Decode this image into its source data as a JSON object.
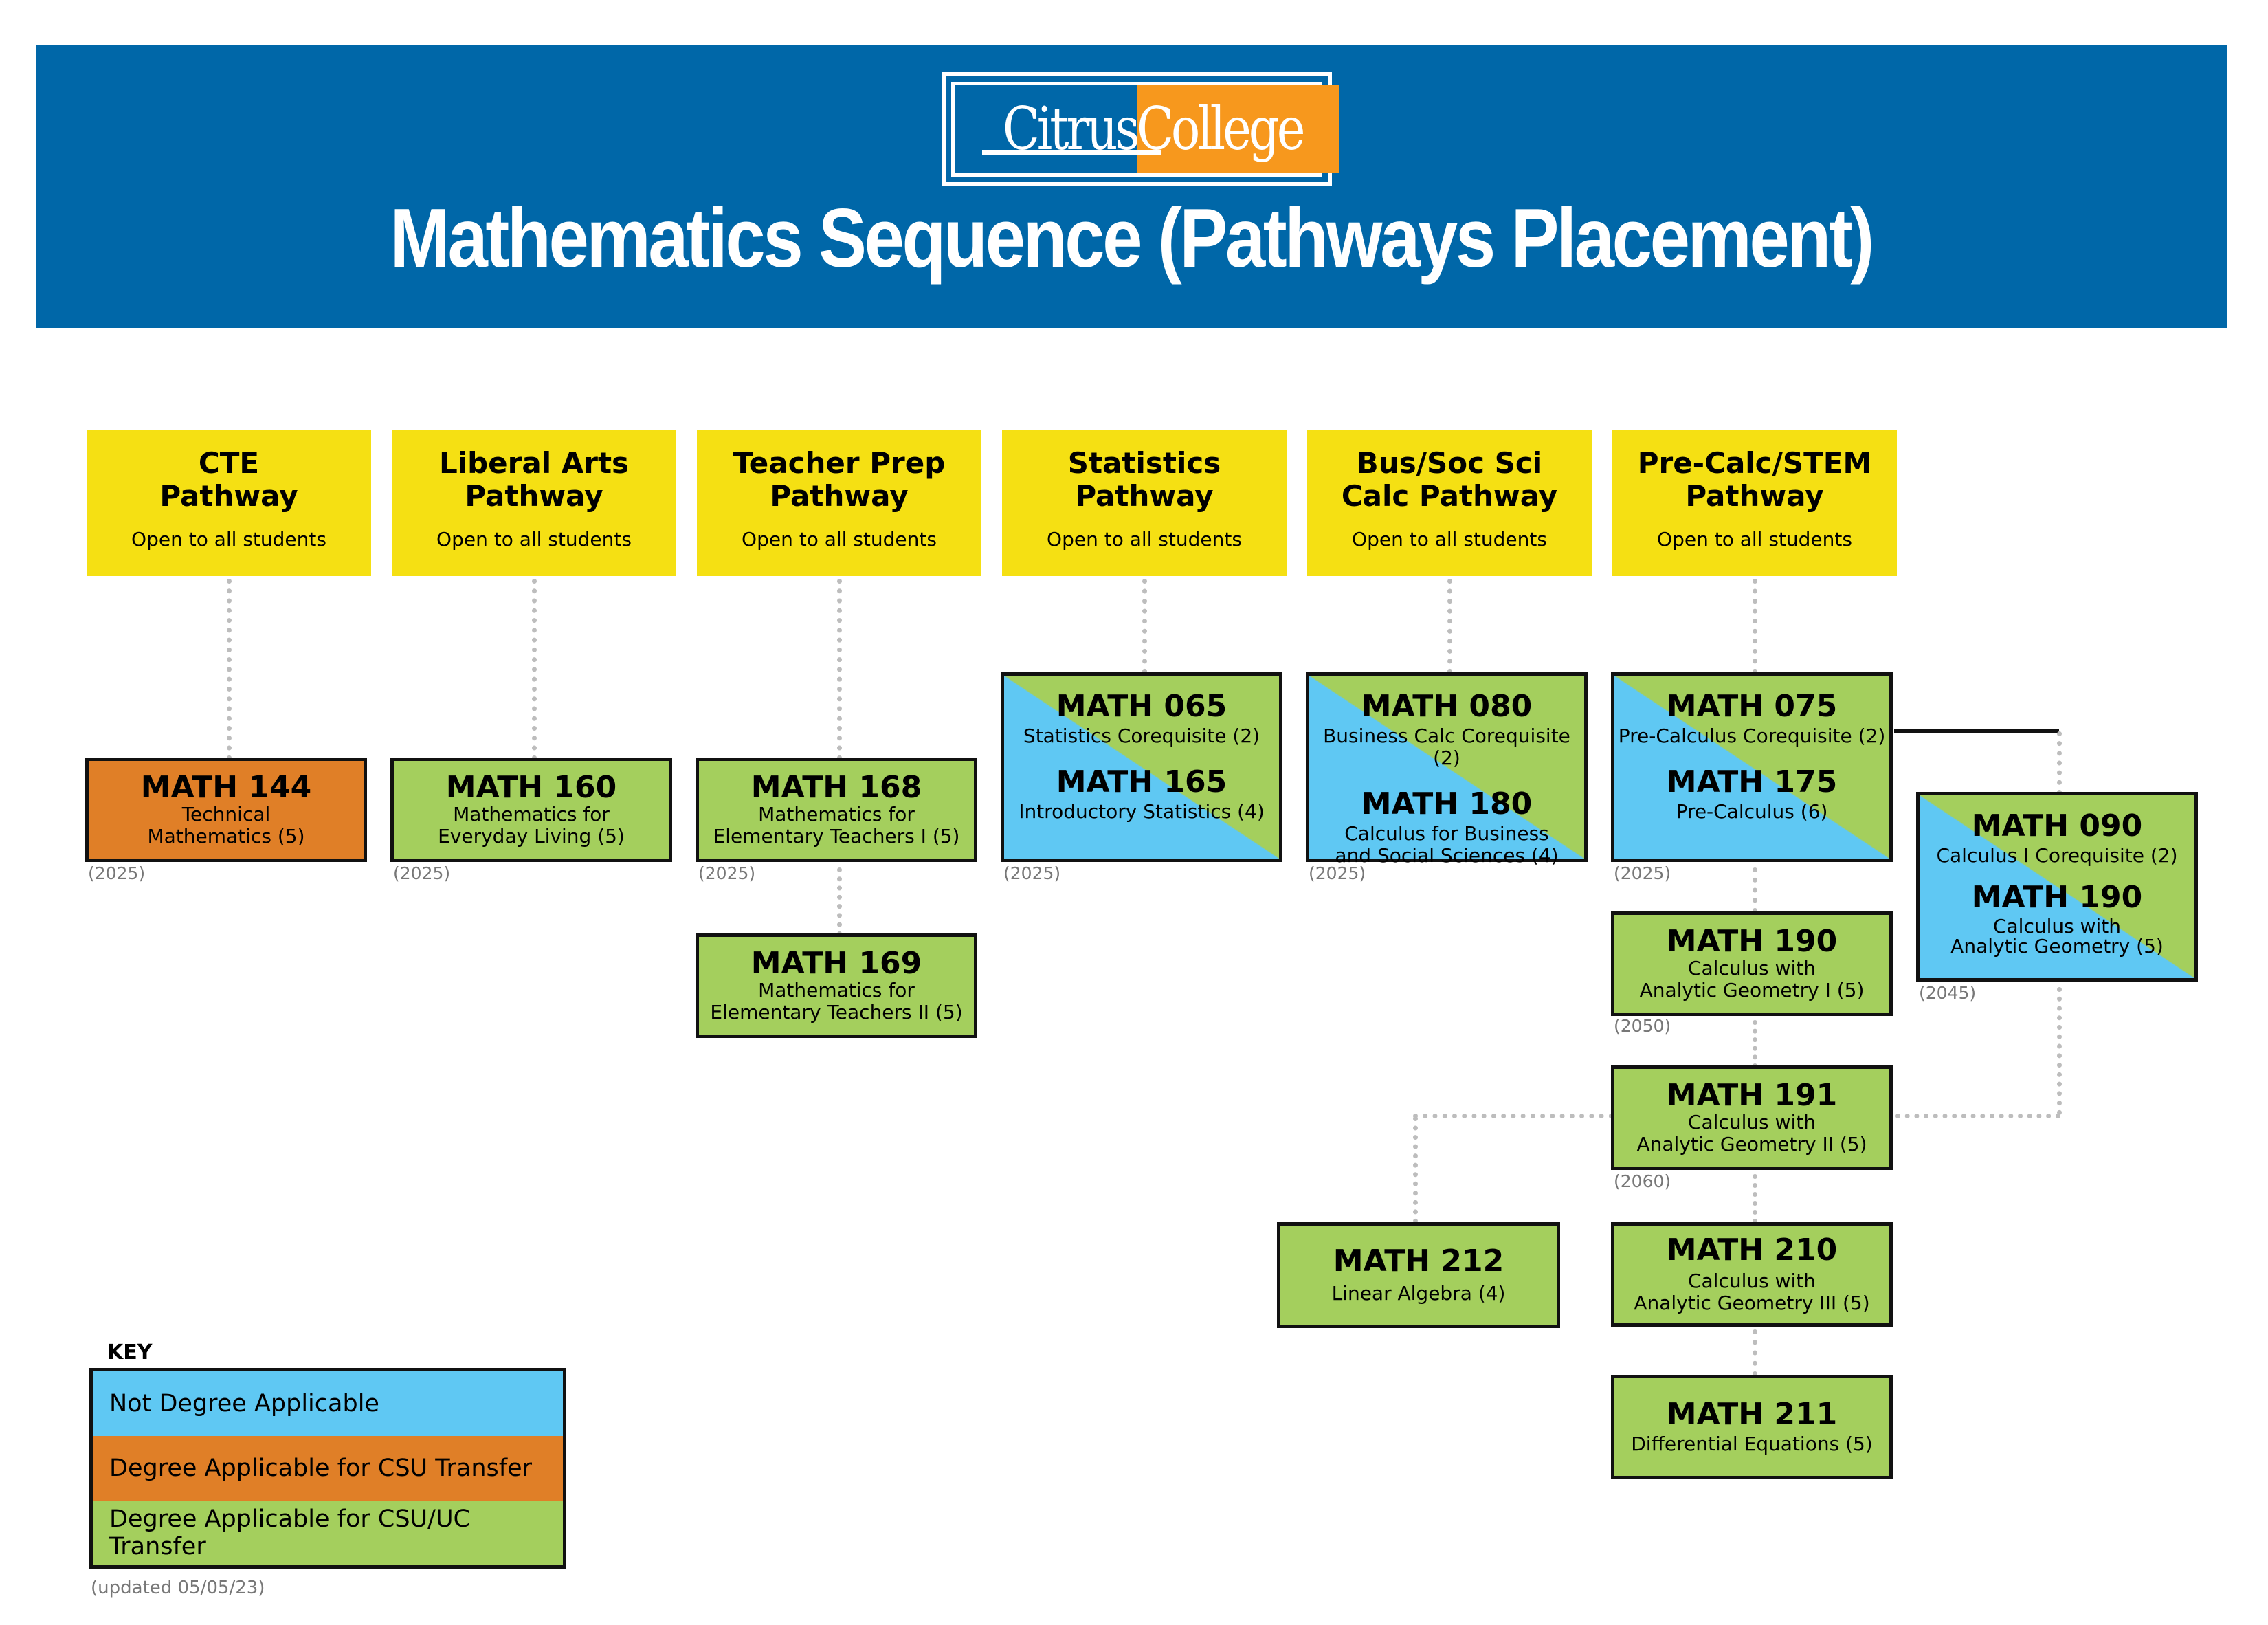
{
  "header": {
    "logo_left": "Citrus",
    "logo_right": "College",
    "title": "Mathematics Sequence (Pathways Placement)",
    "colors": {
      "banner": "#0067a8",
      "logo_accent": "#f7981d"
    }
  },
  "pathways": [
    {
      "name": "CTE\nPathway",
      "note": "Open to all students"
    },
    {
      "name": "Liberal Arts\nPathway",
      "note": "Open to all students"
    },
    {
      "name": "Teacher Prep\nPathway",
      "note": "Open to all students"
    },
    {
      "name": "Statistics\nPathway",
      "note": "Open to all students"
    },
    {
      "name": "Bus/Soc Sci\nCalc Pathway",
      "note": "Open to all students"
    },
    {
      "name": "Pre-Calc/STEM\nPathway",
      "note": "Open to all students"
    }
  ],
  "courses": {
    "math144": {
      "code": "MATH 144",
      "name": "Technical\nMathematics (5)",
      "year": "(2025)",
      "category": "Degree Applicable for CSU Transfer"
    },
    "math160": {
      "code": "MATH 160",
      "name": "Mathematics for\nEveryday Living (5)",
      "year": "(2025)",
      "category": "Degree Applicable for CSU/UC Transfer"
    },
    "math168": {
      "code": "MATH 168",
      "name": "Mathematics for\nElementary Teachers I (5)",
      "year": "(2025)",
      "category": "Degree Applicable for CSU/UC Transfer"
    },
    "math169": {
      "code": "MATH 169",
      "name": "Mathematics for\nElementary Teachers II (5)",
      "category": "Degree Applicable for CSU/UC Transfer"
    },
    "math065_165": {
      "top": {
        "code": "MATH 065",
        "name": "Statistics Corequisite (2)"
      },
      "bottom": {
        "code": "MATH 165",
        "name": "Introductory Statistics (4)"
      },
      "year": "(2025)"
    },
    "math080_180": {
      "top": {
        "code": "MATH 080",
        "name": "Business Calc Corequisite (2)"
      },
      "bottom": {
        "code": "MATH 180",
        "name": "Calculus for Business\nand Social Sciences (4)"
      },
      "year": "(2025)"
    },
    "math075_175": {
      "top": {
        "code": "MATH 075",
        "name": "Pre-Calculus Corequisite (2)"
      },
      "bottom": {
        "code": "MATH 175",
        "name": "Pre-Calculus (6)"
      },
      "year": "(2025)"
    },
    "math090_190": {
      "top": {
        "code": "MATH 090",
        "name": "Calculus I Corequisite (2)"
      },
      "bottom": {
        "code": "MATH 190",
        "name": "Calculus with\nAnalytic Geometry (5)"
      },
      "year": "(2045)"
    },
    "math190": {
      "code": "MATH 190",
      "name": "Calculus with\nAnalytic Geometry I (5)",
      "year": "(2050)"
    },
    "math191": {
      "code": "MATH 191",
      "name": "Calculus with\nAnalytic Geometry II (5)",
      "year": "(2060)"
    },
    "math212": {
      "code": "MATH 212",
      "name": "Linear Algebra (4)"
    },
    "math210": {
      "code": "MATH 210",
      "name": "Calculus with\nAnalytic Geometry III (5)"
    },
    "math211": {
      "code": "MATH 211",
      "name": "Differential Equations (5)"
    }
  },
  "key": {
    "label": "KEY",
    "items": [
      {
        "label": "Not Degree Applicable",
        "color": "#5fc8f3"
      },
      {
        "label": "Degree Applicable for CSU Transfer",
        "color": "#e07f27"
      },
      {
        "label": "Degree Applicable for CSU/UC Transfer",
        "color": "#a4cf5d"
      }
    ],
    "updated": "(updated 05/05/23)"
  }
}
